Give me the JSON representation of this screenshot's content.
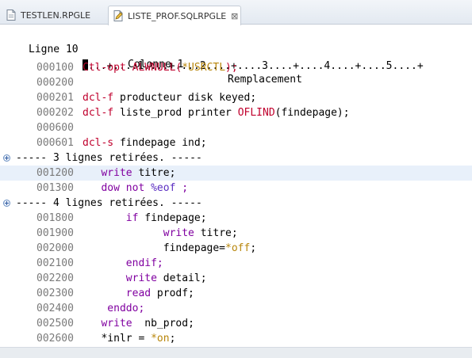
{
  "tabs": [
    {
      "label": "TESTLEN.RPGLE",
      "active": false
    },
    {
      "label": "LISTE_PROF.SQLRPGLE",
      "active": true,
      "close": "⊠"
    }
  ],
  "status": {
    "line": "Ligne 10",
    "column": "Colonne 1",
    "mode": "Remplacement"
  },
  "ruler": "...+....1....+....2....+....3....+....4....+....5....+",
  "lines": [
    {
      "seq": "000100",
      "tokens": [
        {
          "t": "Ctl-opt ALWNULL(",
          "c": "kw"
        },
        {
          "t": "*USRCTL",
          "c": "sp"
        },
        {
          "t": ");",
          "c": "kw"
        }
      ]
    },
    {
      "seq": "000200",
      "tokens": []
    },
    {
      "seq": "000201",
      "tokens": [
        {
          "t": "dcl-f ",
          "c": "kw"
        },
        {
          "t": "producteur disk keyed;",
          "c": "blk"
        }
      ]
    },
    {
      "seq": "000202",
      "tokens": [
        {
          "t": "dcl-f ",
          "c": "kw"
        },
        {
          "t": "liste_prod printer ",
          "c": "blk"
        },
        {
          "t": "OFLIND",
          "c": "kw"
        },
        {
          "t": "(findepage);",
          "c": "blk"
        }
      ]
    },
    {
      "seq": "000600",
      "tokens": []
    },
    {
      "seq": "000601",
      "tokens": [
        {
          "t": "dcl-s ",
          "c": "kw"
        },
        {
          "t": "findepage ind;",
          "c": "blk"
        }
      ]
    },
    {
      "collapsed": "----- 3 lignes retirées. -----"
    },
    {
      "seq": "001200",
      "highlight": true,
      "tokens": [
        {
          "t": "   write ",
          "c": "kw2"
        },
        {
          "t": "titre;",
          "c": "blk"
        }
      ]
    },
    {
      "seq": "001300",
      "tokens": [
        {
          "t": "   dow not ",
          "c": "kw2"
        },
        {
          "t": "%eof",
          "c": "bif"
        },
        {
          "t": " ;",
          "c": "kw2"
        }
      ]
    },
    {
      "collapsed": "----- 4 lignes retirées. -----"
    },
    {
      "seq": "001800",
      "tokens": [
        {
          "t": "       if ",
          "c": "kw2"
        },
        {
          "t": "findepage;",
          "c": "blk"
        }
      ]
    },
    {
      "seq": "001900",
      "tokens": [
        {
          "t": "             write ",
          "c": "kw2"
        },
        {
          "t": "titre;",
          "c": "blk"
        }
      ]
    },
    {
      "seq": "002000",
      "tokens": [
        {
          "t": "             findepage=",
          "c": "blk"
        },
        {
          "t": "*off",
          "c": "sp"
        },
        {
          "t": ";",
          "c": "blk"
        }
      ]
    },
    {
      "seq": "002100",
      "tokens": [
        {
          "t": "       endif;",
          "c": "kw2"
        }
      ]
    },
    {
      "seq": "002200",
      "tokens": [
        {
          "t": "       write ",
          "c": "kw2"
        },
        {
          "t": "detail;",
          "c": "blk"
        }
      ]
    },
    {
      "seq": "002300",
      "tokens": [
        {
          "t": "       read ",
          "c": "kw2"
        },
        {
          "t": "prodf;",
          "c": "blk"
        }
      ]
    },
    {
      "seq": "002400",
      "tokens": [
        {
          "t": "    enddo;",
          "c": "kw2"
        }
      ]
    },
    {
      "seq": "002500",
      "tokens": [
        {
          "t": "   write  ",
          "c": "kw2"
        },
        {
          "t": "nb_prod;",
          "c": "blk"
        }
      ]
    },
    {
      "seq": "002600",
      "tokens": [
        {
          "t": "   *inlr = ",
          "c": "blk"
        },
        {
          "t": "*on",
          "c": "sp"
        },
        {
          "t": ";",
          "c": "blk"
        }
      ]
    }
  ]
}
